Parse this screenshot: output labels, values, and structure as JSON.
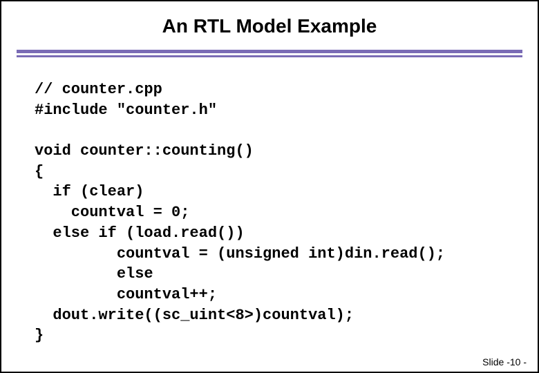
{
  "title": "An RTL Model Example",
  "code_lines": [
    "// counter.cpp",
    "#include \"counter.h\"",
    "",
    "void counter::counting()",
    "{",
    "  if (clear)",
    "    countval = 0;",
    "  else if (load.read())",
    "         countval = (unsigned int)din.read();",
    "         else",
    "         countval++;",
    "  dout.write((sc_uint<8>)countval);",
    "}"
  ],
  "footer_prefix": "Slide -",
  "footer_number": "10",
  "footer_suffix": " -"
}
